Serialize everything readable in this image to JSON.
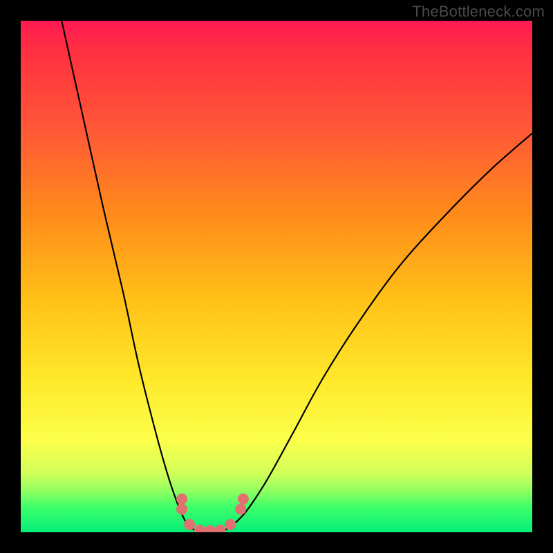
{
  "watermark": "TheBottleneck.com",
  "colors": {
    "frame": "#000000",
    "gradient_stops": [
      "#ff1a52",
      "#ff3040",
      "#ff5a36",
      "#ff8c1a",
      "#ffc218",
      "#ffe82a",
      "#fcff4a",
      "#d0ff5a",
      "#8fff60",
      "#3fff6a",
      "#04ef79"
    ],
    "curve": "#000000",
    "marker_fill": "#e17070",
    "marker_stroke": "#c95b5b"
  },
  "chart_data": {
    "type": "line",
    "title": "",
    "xlabel": "",
    "ylabel": "",
    "xlim": [
      0,
      100
    ],
    "ylim": [
      0,
      100
    ],
    "grid": false,
    "legend": false,
    "series": [
      {
        "name": "left-branch",
        "x": [
          8,
          12,
          16,
          20,
          23,
          26,
          28.5,
          30.5,
          32,
          33,
          34
        ],
        "y": [
          100,
          82,
          64,
          47,
          33,
          21,
          12,
          6,
          2.5,
          1,
          0.5
        ]
      },
      {
        "name": "valley",
        "x": [
          34,
          35,
          36,
          37,
          38,
          39,
          40,
          41
        ],
        "y": [
          0.5,
          0.3,
          0.2,
          0.2,
          0.2,
          0.3,
          0.5,
          1
        ]
      },
      {
        "name": "right-branch",
        "x": [
          41,
          44,
          48,
          53,
          59,
          66,
          74,
          83,
          92,
          100
        ],
        "y": [
          1,
          4,
          10,
          19,
          30,
          41,
          52,
          62,
          71,
          78
        ]
      }
    ],
    "markers": [
      {
        "x": 31.5,
        "y": 6.5
      },
      {
        "x": 31.5,
        "y": 4.5
      },
      {
        "x": 33,
        "y": 1.5
      },
      {
        "x": 35,
        "y": 0.4
      },
      {
        "x": 37,
        "y": 0.3
      },
      {
        "x": 39,
        "y": 0.4
      },
      {
        "x": 41,
        "y": 1.5
      },
      {
        "x": 43,
        "y": 4.5
      },
      {
        "x": 43.5,
        "y": 6.5
      }
    ]
  }
}
